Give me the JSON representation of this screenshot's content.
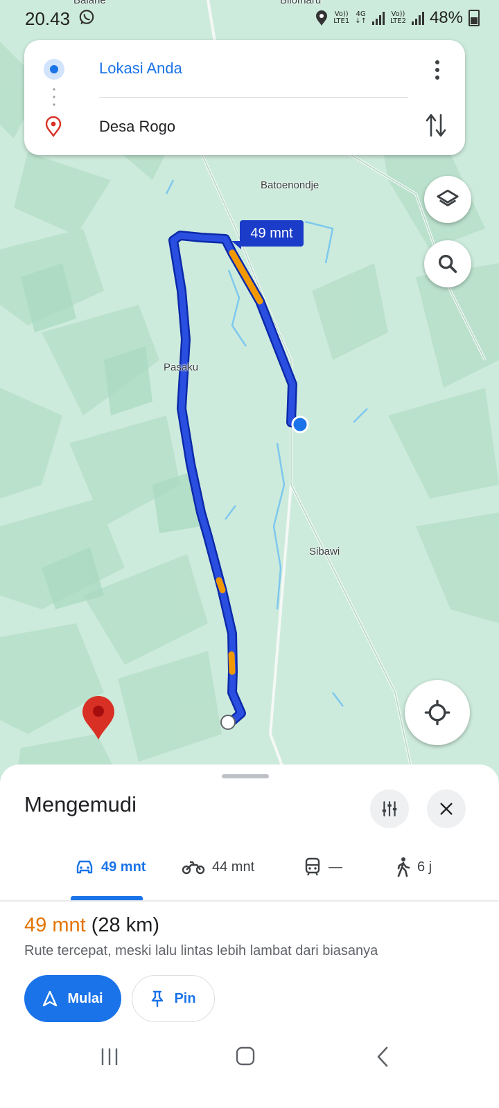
{
  "status_bar": {
    "time": "20.43",
    "sim1_top": "Vo))",
    "sim1_bottom": "LTE1",
    "net_top": "4G",
    "net_bottom": "↓↑",
    "sim2_top": "Vo))",
    "sim2_bottom": "LTE2",
    "battery": "48%"
  },
  "route_card": {
    "from": "Lokasi Anda",
    "to": "Desa Rogo"
  },
  "map": {
    "labels": {
      "top_cut": "Balane",
      "top_cut2": "Bilomaru",
      "batoenondje": "Batoenondje",
      "pasaku": "Pasaku",
      "sibawi": "Sibawi"
    },
    "eta_bubble": "49 mnt",
    "colors": {
      "route": "#1a3cc9",
      "traffic": "#f29900",
      "destination": "#d93025",
      "water": "#7ec8ee"
    }
  },
  "sheet": {
    "title": "Mengemudi",
    "modes": [
      {
        "icon": "car-icon",
        "label": "49 mnt",
        "active": true
      },
      {
        "icon": "motorcycle-icon",
        "label": "44 mnt",
        "active": false
      },
      {
        "icon": "transit-icon",
        "label": "—",
        "active": false
      },
      {
        "icon": "walk-icon",
        "label": "6 j",
        "active": false
      }
    ],
    "summary_time": "49 mnt",
    "summary_distance": "(28 km)",
    "description": "Rute tercepat, meski lalu lintas lebih lambat dari biasanya",
    "start_label": "Mulai",
    "pin_label": "Pin"
  }
}
